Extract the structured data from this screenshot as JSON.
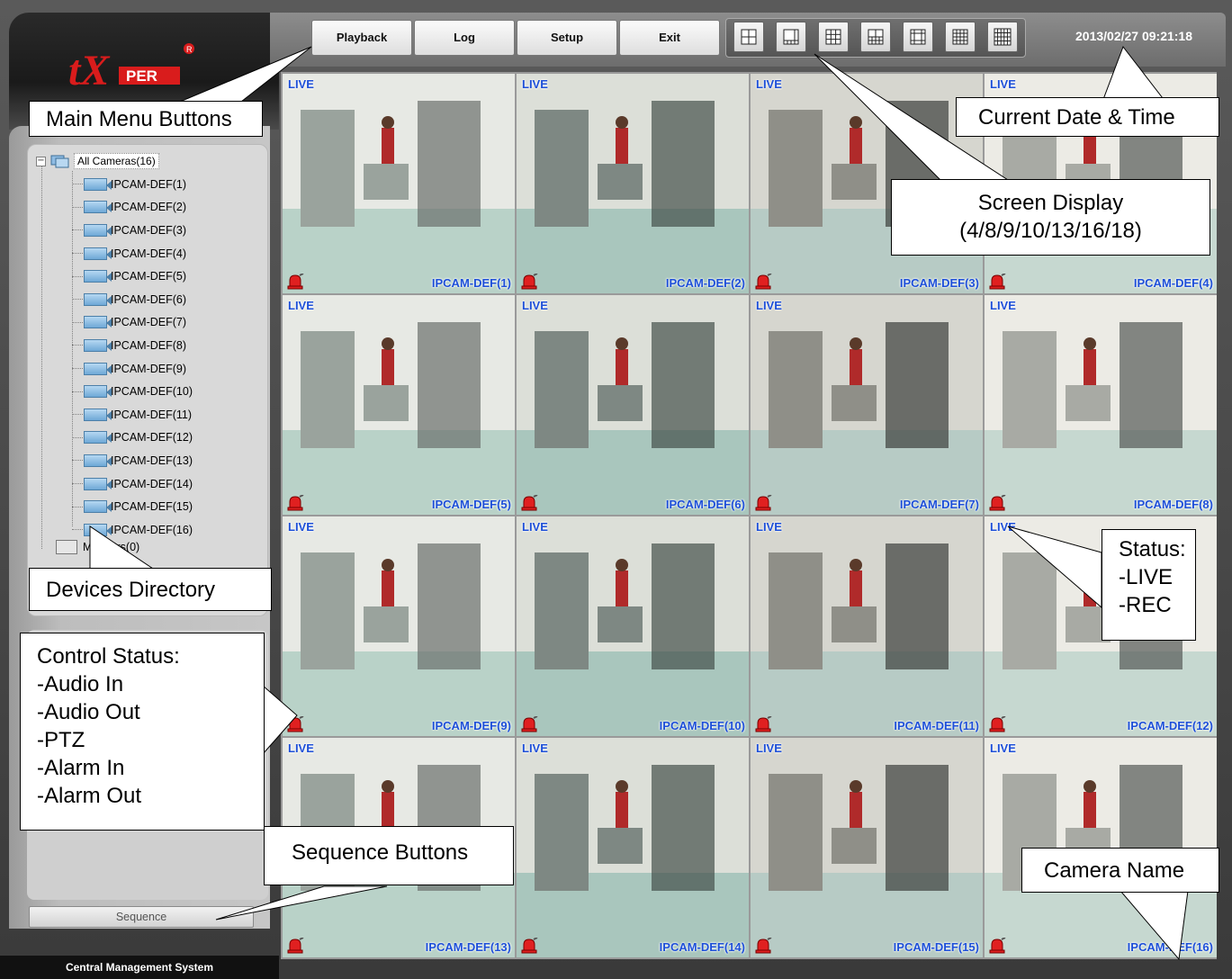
{
  "app": {
    "brand": "tXPER",
    "footer_title": "Central Management System"
  },
  "menu": {
    "buttons": [
      "Playback",
      "Log",
      "Setup",
      "Exit"
    ]
  },
  "layout_modes": {
    "icons": [
      "layout-4-icon",
      "layout-8-icon",
      "layout-9-icon",
      "layout-10-icon",
      "layout-13-icon",
      "layout-16-icon",
      "layout-18-icon"
    ]
  },
  "datetime": "2013/02/27 09:21:18",
  "devices": {
    "root_label": "All Cameras(16)",
    "cameras": [
      "IPCAM-DEF(1)",
      "IPCAM-DEF(2)",
      "IPCAM-DEF(3)",
      "IPCAM-DEF(4)",
      "IPCAM-DEF(5)",
      "IPCAM-DEF(6)",
      "IPCAM-DEF(7)",
      "IPCAM-DEF(8)",
      "IPCAM-DEF(9)",
      "IPCAM-DEF(10)",
      "IPCAM-DEF(11)",
      "IPCAM-DEF(12)",
      "IPCAM-DEF(13)",
      "IPCAM-DEF(14)",
      "IPCAM-DEF(15)",
      "IPCAM-DEF(16)"
    ],
    "monitors_label": "Monitors(0)"
  },
  "sequence_button": "Sequence",
  "tiles": [
    {
      "status": "LIVE",
      "name": "IPCAM-DEF(1)"
    },
    {
      "status": "LIVE",
      "name": "IPCAM-DEF(2)"
    },
    {
      "status": "LIVE",
      "name": "IPCAM-DEF(3)"
    },
    {
      "status": "LIVE",
      "name": "IPCAM-DEF(4)"
    },
    {
      "status": "LIVE",
      "name": "IPCAM-DEF(5)"
    },
    {
      "status": "LIVE",
      "name": "IPCAM-DEF(6)"
    },
    {
      "status": "LIVE",
      "name": "IPCAM-DEF(7)"
    },
    {
      "status": "LIVE",
      "name": "IPCAM-DEF(8)"
    },
    {
      "status": "LIVE",
      "name": "IPCAM-DEF(9)"
    },
    {
      "status": "LIVE",
      "name": "IPCAM-DEF(10)"
    },
    {
      "status": "LIVE",
      "name": "IPCAM-DEF(11)"
    },
    {
      "status": "LIVE",
      "name": "IPCAM-DEF(12)"
    },
    {
      "status": "LIVE",
      "name": "IPCAM-DEF(13)"
    },
    {
      "status": "LIVE",
      "name": "IPCAM-DEF(14)"
    },
    {
      "status": "LIVE",
      "name": "IPCAM-DEF(15)"
    },
    {
      "status": "LIVE",
      "name": "IPCAM-DEF(16)"
    }
  ],
  "annotations": {
    "main_menu": "Main Menu Buttons",
    "datetime": "Current Date & Time",
    "screen_display": "Screen Display\n(4/8/9/10/13/16/18)",
    "devices_directory": "Devices Directory",
    "status": "Status:\n-LIVE\n-REC",
    "control_status": "Control Status:\n-Audio In\n-Audio Out\n-PTZ\n-Alarm In\n-Alarm Out",
    "sequence_buttons": "Sequence Buttons",
    "camera_name": "Camera Name"
  },
  "colors": {
    "label_blue": "#1d4fd8",
    "logo_red": "#d91c1c"
  }
}
